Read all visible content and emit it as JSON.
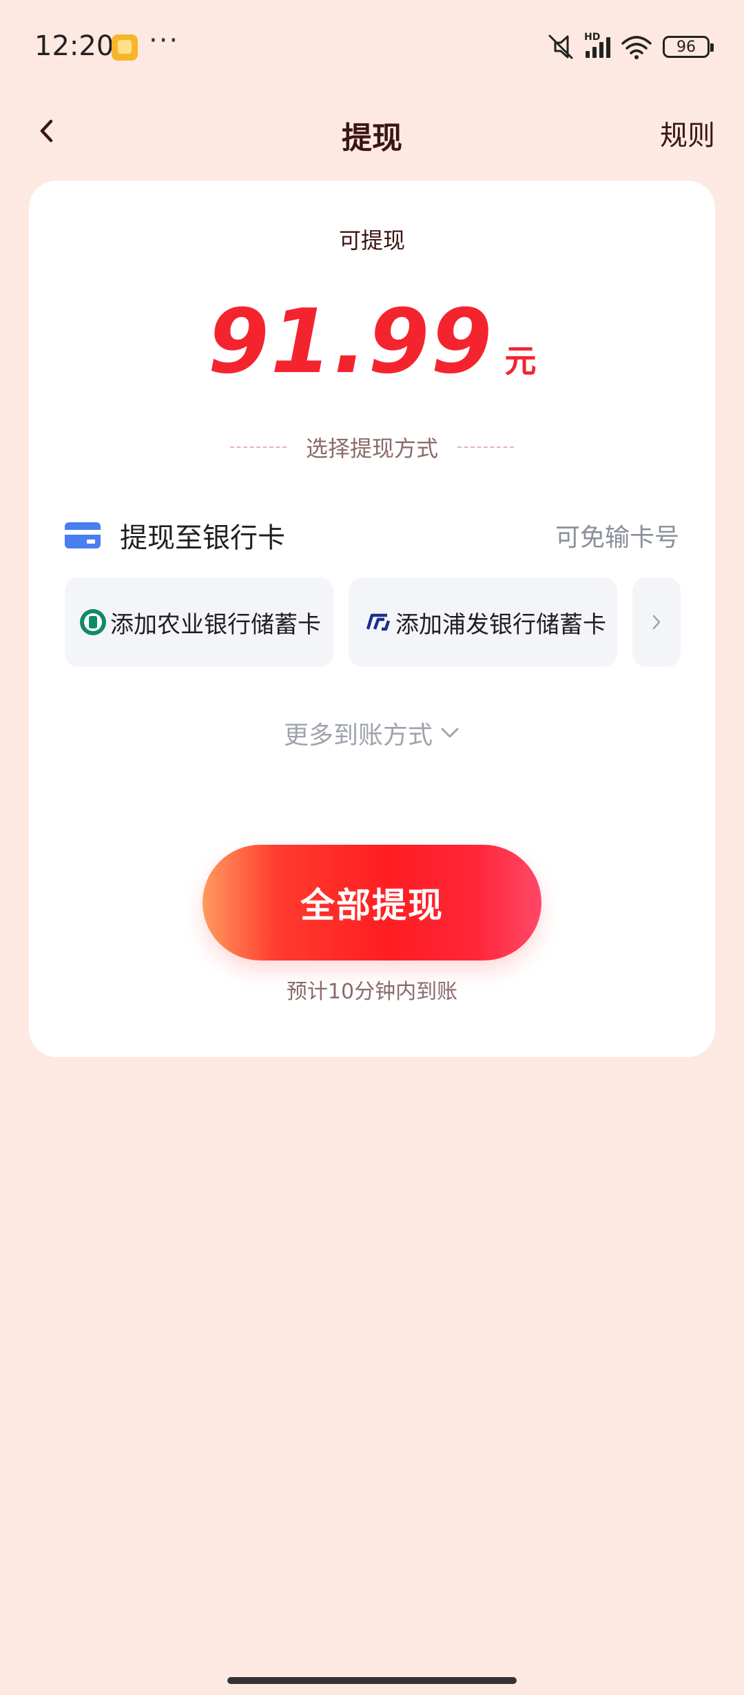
{
  "status_bar": {
    "time": "12:20",
    "overflow": "···",
    "network_label": "HD",
    "battery": "96",
    "icons": [
      "app-notification-icon",
      "mute-icon",
      "signal-icon",
      "wifi-icon",
      "battery-icon"
    ]
  },
  "nav": {
    "back_icon": "chevron-left-icon",
    "title": "提现",
    "rules": "规则"
  },
  "balance": {
    "label": "可提现",
    "amount": "91.99",
    "unit": "元"
  },
  "method": {
    "divider_label": "选择提现方式",
    "bank_title": "提现至银行卡",
    "bank_hint": "可免输卡号",
    "options": [
      {
        "label": "添加农业银行储蓄卡",
        "icon": "abc-bank-logo"
      },
      {
        "label": "添加浦发银行储蓄卡",
        "icon": "spdb-bank-logo"
      }
    ],
    "more_arrow_icon": "chevron-right-icon",
    "more_label": "更多到账方式"
  },
  "action": {
    "button_label": "全部提现",
    "eta": "预计10分钟内到账"
  },
  "colors": {
    "background": "#fde9e2",
    "accent_red": "#f4242f",
    "card_blue": "#4a7df0",
    "abc_green": "#0f8a67",
    "spdb_blue": "#1a2f8f"
  }
}
